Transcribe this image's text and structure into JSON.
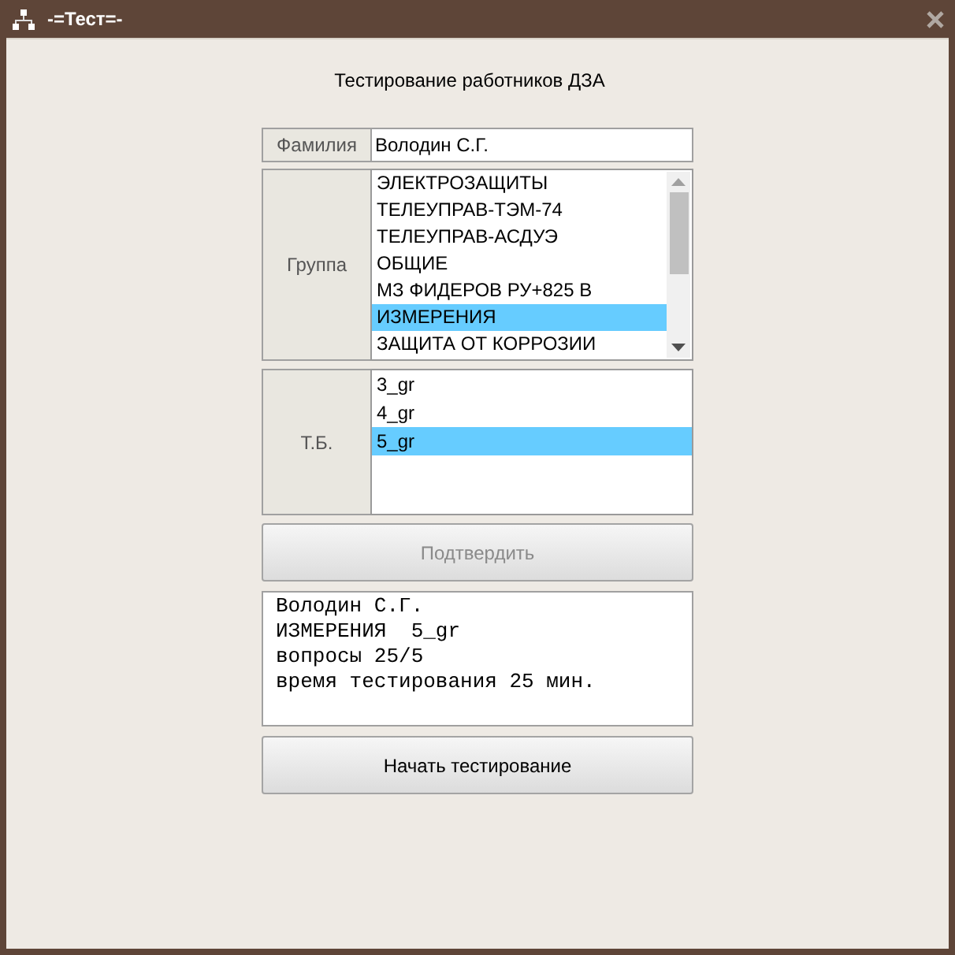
{
  "window": {
    "title": "-=Тест=-"
  },
  "heading": "Тестирование работников ДЗА",
  "surname": {
    "label": "Фамилия",
    "value": "Володин С.Г."
  },
  "group": {
    "label": "Группа",
    "items": [
      {
        "label": "ЭЛЕКТРОЗАЩИТЫ",
        "selected": false
      },
      {
        "label": "ТЕЛЕУПРАВ-ТЭМ-74",
        "selected": false
      },
      {
        "label": "ТЕЛЕУПРАВ-АСДУЭ",
        "selected": false
      },
      {
        "label": "ОБЩИЕ",
        "selected": false
      },
      {
        "label": "МЗ ФИДЕРОВ РУ+825 В",
        "selected": false
      },
      {
        "label": "ИЗМЕРЕНИЯ",
        "selected": true
      },
      {
        "label": "ЗАЩИТА ОТ КОРРОЗИИ",
        "selected": false
      }
    ]
  },
  "tb": {
    "label": "Т.Б.",
    "items": [
      {
        "label": "3_gr",
        "selected": false
      },
      {
        "label": "4_gr",
        "selected": false
      },
      {
        "label": "5_gr",
        "selected": true
      }
    ]
  },
  "confirm_button": {
    "label": "Подтвердить",
    "disabled": true
  },
  "summary": {
    "lines": [
      "Володин С.Г.",
      "ИЗМЕРЕНИЯ  5_gr",
      "вопросы 25/5",
      "время тестирования 25 мин."
    ]
  },
  "start_button": {
    "label": "Начать тестирование",
    "disabled": false
  }
}
